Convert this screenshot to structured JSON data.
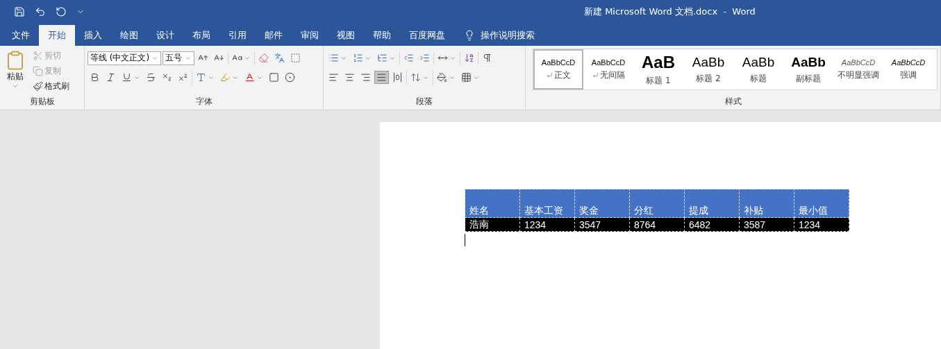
{
  "title": "新建 Microsoft Word 文档.docx  -  Word",
  "menu_tabs": [
    {
      "label": "文件",
      "selected": false
    },
    {
      "label": "开始",
      "selected": true
    },
    {
      "label": "插入",
      "selected": false
    },
    {
      "label": "绘图",
      "selected": false
    },
    {
      "label": "设计",
      "selected": false
    },
    {
      "label": "布局",
      "selected": false
    },
    {
      "label": "引用",
      "selected": false
    },
    {
      "label": "邮件",
      "selected": false
    },
    {
      "label": "审阅",
      "selected": false
    },
    {
      "label": "视图",
      "selected": false
    },
    {
      "label": "帮助",
      "selected": false
    },
    {
      "label": "百度网盘",
      "selected": false
    }
  ],
  "tell_me": "操作说明搜索",
  "clipboard": {
    "paste": "粘贴",
    "items": [
      {
        "label": "剪切",
        "disabled": true
      },
      {
        "label": "复制",
        "disabled": true
      },
      {
        "label": "格式刷",
        "disabled": false
      }
    ],
    "group_label": "剪贴板"
  },
  "font": {
    "font_name": "等线 (中文正文)",
    "font_size": "五号",
    "group_label": "字体"
  },
  "paragraph": {
    "align_buttons": [
      {
        "selected": false
      },
      {
        "selected": false
      },
      {
        "selected": false
      },
      {
        "selected": true
      },
      {
        "selected": false
      }
    ],
    "group_label": "段落"
  },
  "styles": {
    "items": [
      {
        "sample": "AaBbCcD",
        "name": "正文",
        "kind": "normal",
        "selected": true,
        "mark": true
      },
      {
        "sample": "AaBbCcD",
        "name": "无间隔",
        "kind": "normal",
        "selected": false,
        "mark": true
      },
      {
        "sample": "AaB",
        "name": "标题 1",
        "kind": "heading1",
        "selected": false,
        "mark": false
      },
      {
        "sample": "AaBb",
        "name": "标题 2",
        "kind": "heading",
        "selected": false,
        "mark": false
      },
      {
        "sample": "AaBb",
        "name": "标题",
        "kind": "heading",
        "selected": false,
        "mark": false
      },
      {
        "sample": "AaBb",
        "name": "副标题",
        "kind": "subtitle",
        "selected": false,
        "mark": false
      },
      {
        "sample": "AaBbCcD",
        "name": "不明显强调",
        "kind": "subtle",
        "selected": false,
        "mark": false
      },
      {
        "sample": "AaBbCcD",
        "name": "强调",
        "kind": "emphasis",
        "selected": false,
        "mark": false
      }
    ],
    "group_label": "样式"
  },
  "table": {
    "columns": [
      "姓名",
      "基本工资",
      "奖金",
      "分红",
      "提成",
      "补贴",
      "最小值"
    ],
    "rows": [
      [
        "浩南",
        "1234",
        "3547",
        "8764",
        "6482",
        "3587",
        "1234"
      ]
    ]
  }
}
